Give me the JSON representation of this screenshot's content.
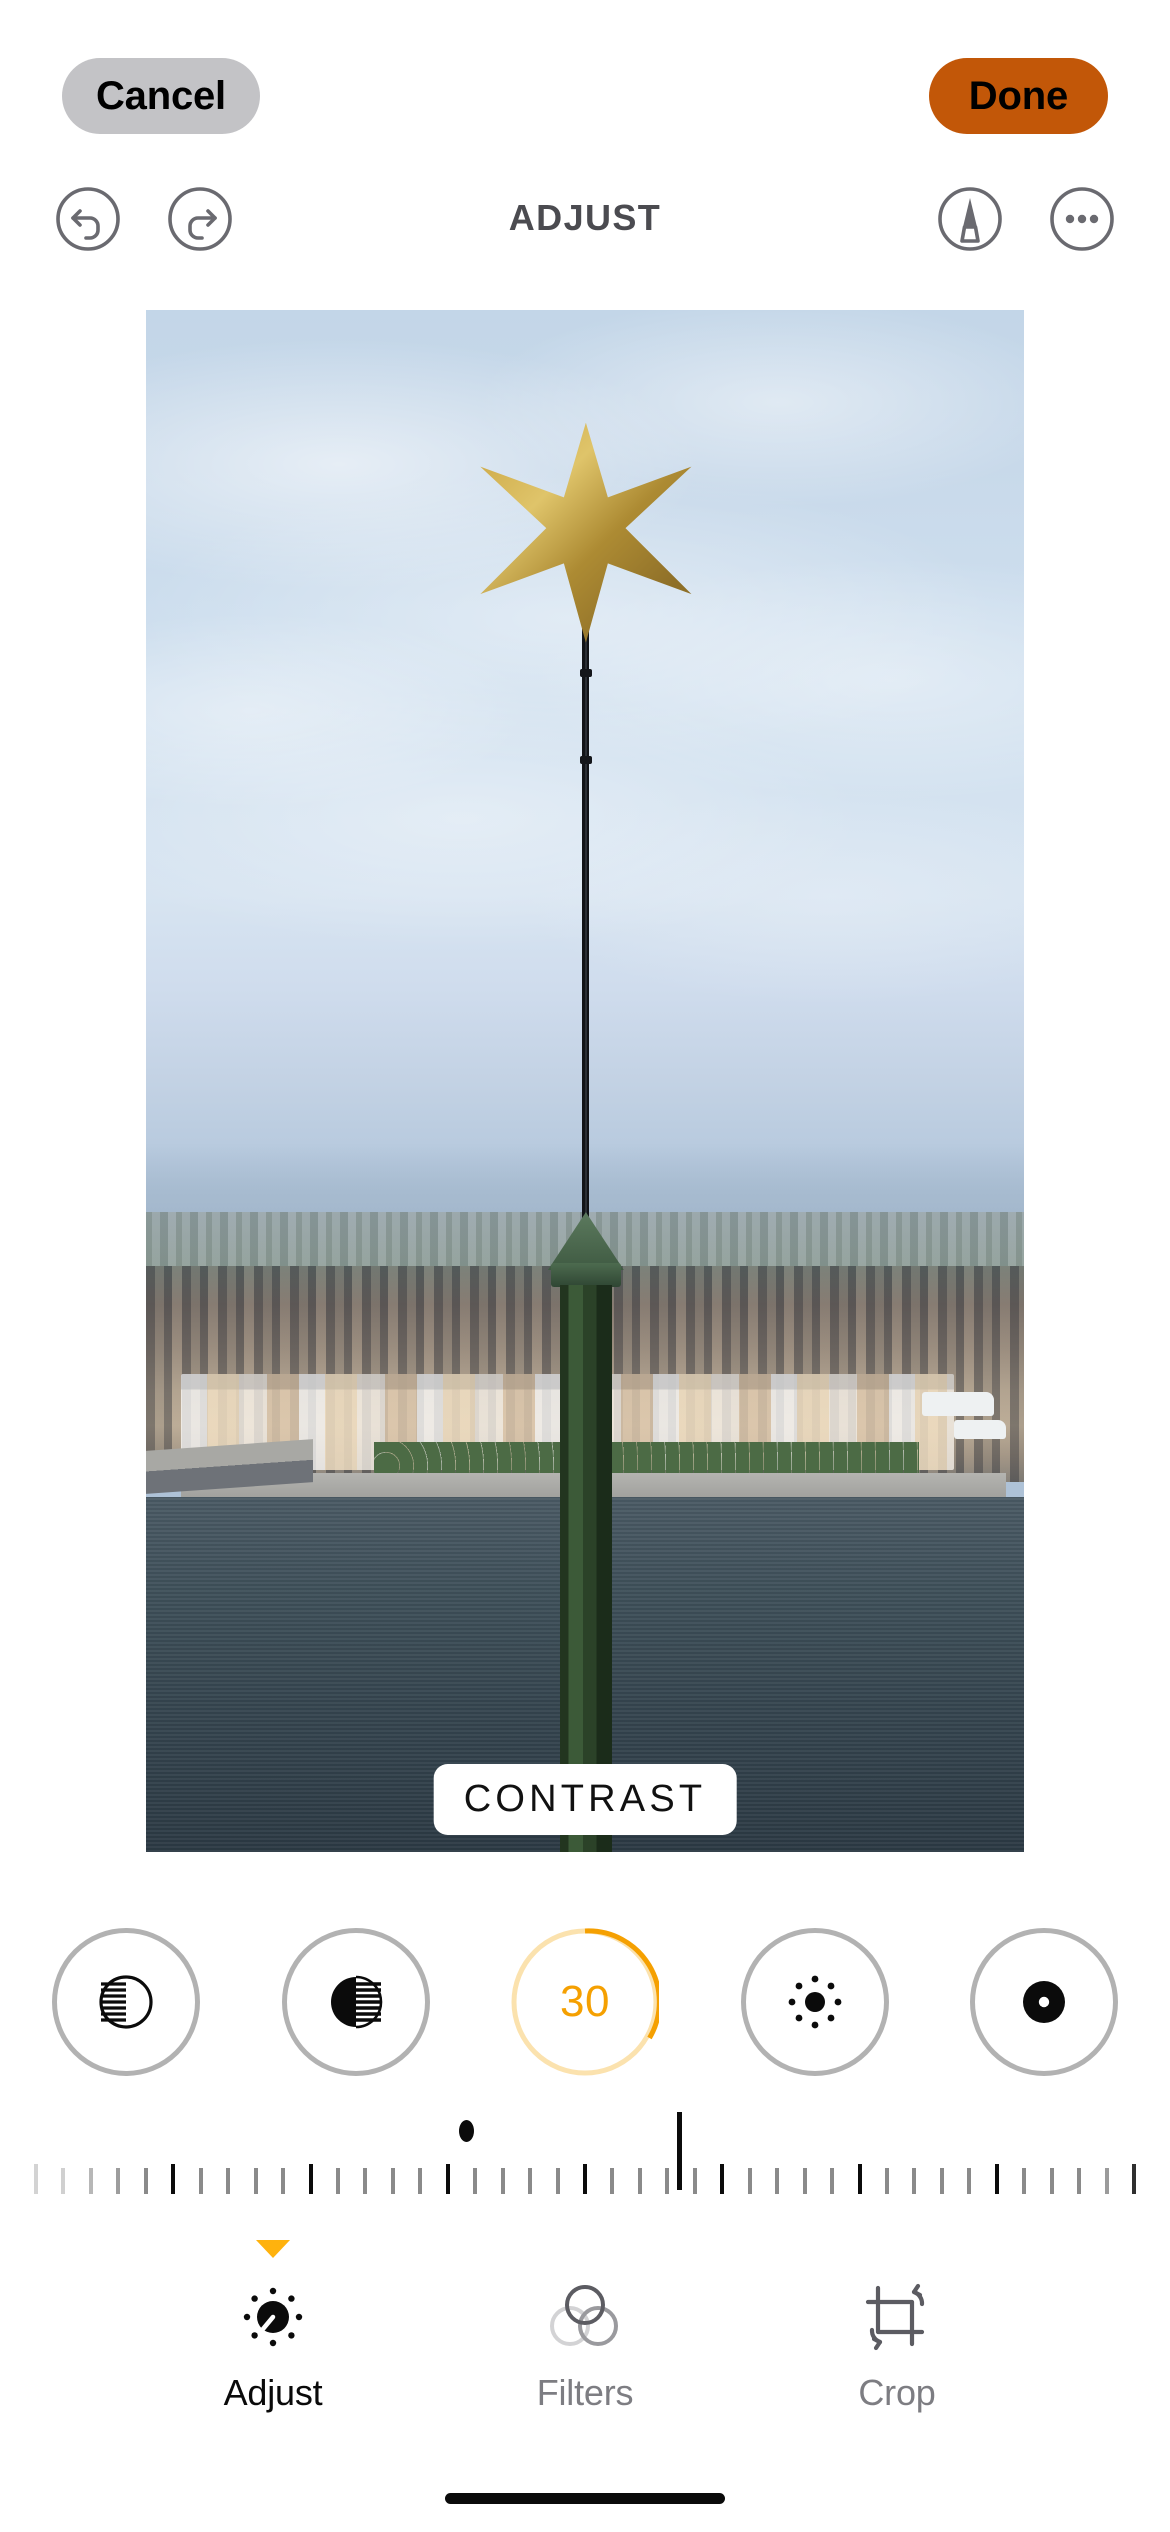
{
  "app": {
    "screen_title": "ADJUST"
  },
  "top_bar": {
    "cancel_label": "Cancel",
    "done_label": "Done",
    "cancel_bg": "#c3c3c6",
    "done_bg": "#c25708"
  },
  "edit_toolbar": {
    "title": "ADJUST",
    "undo_icon": "undo-arrow-icon",
    "redo_icon": "redo-arrow-icon",
    "markup_icon": "markup-pen-icon",
    "more_icon": "more-ellipsis-icon",
    "icon_color": "#6a6a70"
  },
  "photo": {
    "overlay_label": "CONTRAST",
    "description": "Aerial view over Stockholm with a golden six-pointed star on a black pole in the foreground, Riddarholmen island and harbour water below"
  },
  "adjustments": {
    "active_index": 2,
    "accent_color": "#f5a001",
    "arc_track_color": "#fbe2ae",
    "ring_color": "#b2b2b2",
    "items": [
      {
        "name": "Brilliance",
        "icon": "brilliance-icon",
        "value": null,
        "active": false
      },
      {
        "name": "Highlights",
        "icon": "highlights-icon",
        "value": null,
        "active": false
      },
      {
        "name": "Contrast",
        "icon": "contrast-icon",
        "value": "30",
        "percent": 30,
        "active": true
      },
      {
        "name": "Brightness",
        "icon": "brightness-sun-icon",
        "value": null,
        "active": false
      },
      {
        "name": "Black Point",
        "icon": "black-point-icon",
        "value": null,
        "active": false
      }
    ]
  },
  "slider": {
    "name": "contrast-ruler-slider",
    "value": 30,
    "indicator_position_pct": 58.6,
    "neutral_dot_position_pct": 39.2,
    "tick_count": 41,
    "major_tick_every": 5
  },
  "tabs": [
    {
      "label": "Adjust",
      "icon": "adjust-dial-icon",
      "active": true
    },
    {
      "label": "Filters",
      "icon": "filters-circles-icon",
      "active": false
    },
    {
      "label": "Crop",
      "icon": "crop-rotate-icon",
      "active": false
    }
  ],
  "home_indicator": {
    "name": "home-indicator"
  }
}
